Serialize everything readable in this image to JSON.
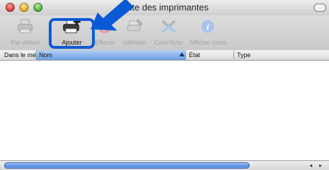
{
  "window": {
    "title": "Liste des imprimantes"
  },
  "toolbar": {
    "items": [
      {
        "label": "Par défaut",
        "icon": "printer-default-icon",
        "enabled": false
      },
      {
        "label": "Ajouter",
        "icon": "add-printer-icon",
        "enabled": true
      },
      {
        "label": "Effacer",
        "icon": "delete-icon",
        "enabled": false
      },
      {
        "label": "Utilitaire",
        "icon": "utility-icon",
        "enabled": false
      },
      {
        "label": "ColorSync",
        "icon": "colorsync-icon",
        "enabled": false
      },
      {
        "label": "Afficher Infos",
        "icon": "info-icon",
        "enabled": false
      }
    ]
  },
  "list": {
    "columns": [
      "Dans le menu",
      "Nom",
      "État",
      "Type"
    ]
  },
  "colors": {
    "highlight": "#0a5ad6",
    "selected_column": "#6b9fe3"
  }
}
